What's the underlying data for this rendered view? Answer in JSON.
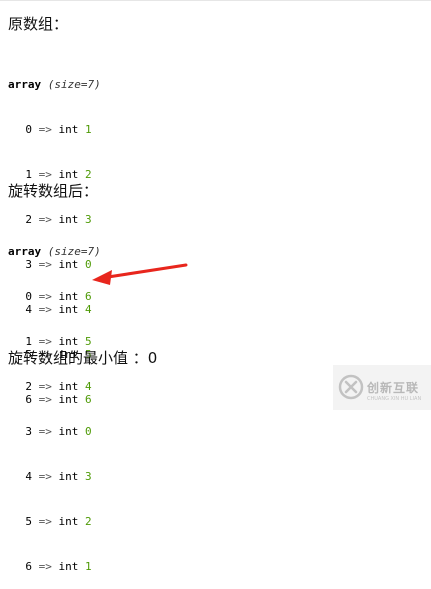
{
  "section1": {
    "heading": "原数组：",
    "keyword": "array",
    "size_note": "(size=7)",
    "rows": [
      {
        "index": "0",
        "arrow": "=>",
        "type": "int",
        "value": "1"
      },
      {
        "index": "1",
        "arrow": "=>",
        "type": "int",
        "value": "2"
      },
      {
        "index": "2",
        "arrow": "=>",
        "type": "int",
        "value": "3"
      },
      {
        "index": "3",
        "arrow": "=>",
        "type": "int",
        "value": "0"
      },
      {
        "index": "4",
        "arrow": "=>",
        "type": "int",
        "value": "4"
      },
      {
        "index": "5",
        "arrow": "=>",
        "type": "int",
        "value": "5"
      },
      {
        "index": "6",
        "arrow": "=>",
        "type": "int",
        "value": "6"
      }
    ]
  },
  "section2": {
    "heading": "旋转数组后：",
    "keyword": "array",
    "size_note": "(size=7)",
    "rows": [
      {
        "index": "0",
        "arrow": "=>",
        "type": "int",
        "value": "6"
      },
      {
        "index": "1",
        "arrow": "=>",
        "type": "int",
        "value": "5"
      },
      {
        "index": "2",
        "arrow": "=>",
        "type": "int",
        "value": "4"
      },
      {
        "index": "3",
        "arrow": "=>",
        "type": "int",
        "value": "0"
      },
      {
        "index": "4",
        "arrow": "=>",
        "type": "int",
        "value": "3"
      },
      {
        "index": "5",
        "arrow": "=>",
        "type": "int",
        "value": "2"
      },
      {
        "index": "6",
        "arrow": "=>",
        "type": "int",
        "value": "1"
      }
    ]
  },
  "result": {
    "text": "旋转数组的最小值 ：0"
  },
  "annotation": {
    "icon": "red-arrow-icon",
    "color": "#e8261d"
  },
  "watermark": {
    "brand_cn": "创新互联",
    "brand_en": "CHUANG XIN HU LIAN",
    "icon": "brand-logo-icon"
  },
  "colors": {
    "value_green": "#4e9a06",
    "text": "#111111"
  }
}
